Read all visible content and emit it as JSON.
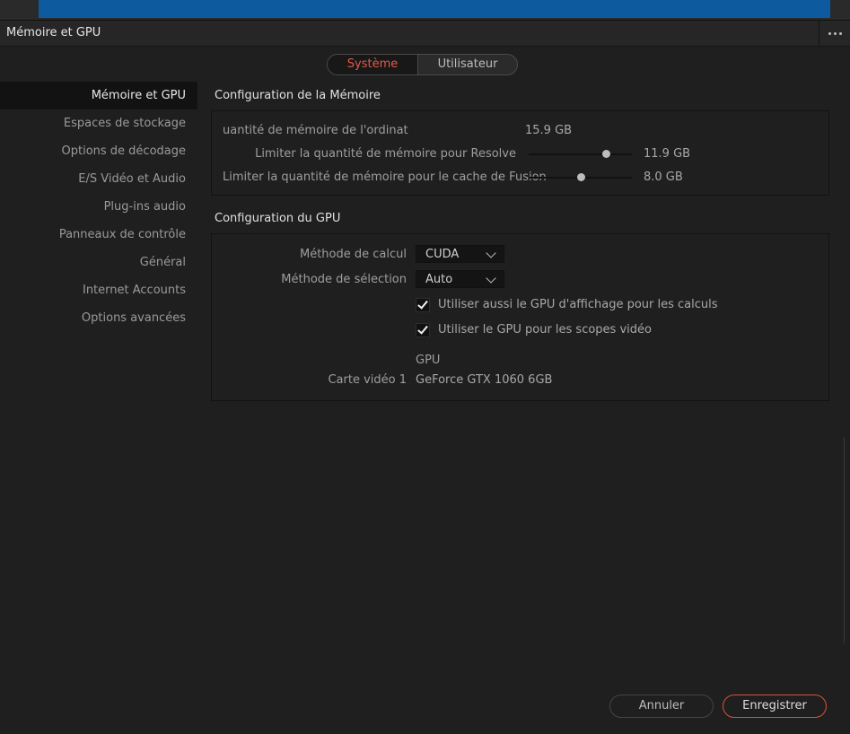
{
  "window": {
    "title": "Mémoire et GPU"
  },
  "tabs": [
    {
      "label": "Système",
      "active": true
    },
    {
      "label": "Utilisateur",
      "active": false
    }
  ],
  "sidebar": {
    "items": [
      {
        "label": "Mémoire et GPU",
        "active": true
      },
      {
        "label": "Espaces de stockage"
      },
      {
        "label": "Options de décodage"
      },
      {
        "label": "E/S Vidéo et Audio"
      },
      {
        "label": "Plug-ins audio"
      },
      {
        "label": "Panneaux de contrôle"
      },
      {
        "label": "Général"
      },
      {
        "label": "Internet Accounts"
      },
      {
        "label": "Options avancées"
      }
    ]
  },
  "memory": {
    "title": "Configuration de la Mémoire",
    "system_label": "uantité de mémoire de l'ordinateur",
    "system_value": "15.9 GB",
    "resolve_label": "Limiter la quantité de mémoire pour Resolve",
    "resolve_value": "11.9 GB",
    "resolve_fraction": 0.75,
    "fusion_label": "Limiter la quantité de mémoire pour le cache de Fusion",
    "fusion_value": "8.0 GB",
    "fusion_fraction": 0.5
  },
  "gpu": {
    "title": "Configuration du GPU",
    "compute_label": "Méthode de calcul",
    "compute_value": "CUDA",
    "selection_label": "Méthode de sélection",
    "selection_value": "Auto",
    "use_display_gpu": {
      "label": "Utiliser aussi le GPU d'affichage pour les calculs",
      "checked": true
    },
    "use_gpu_scopes": {
      "label": "Utiliser le GPU pour les scopes vidéo",
      "checked": true
    },
    "gpu_header": "GPU",
    "card_label": "Carte vidéo 1",
    "card_value": "GeForce GTX 1060 6GB"
  },
  "footer": {
    "cancel_label": "Annuler",
    "save_label": "Enregistrer",
    "accent_color": "#d8503f"
  }
}
